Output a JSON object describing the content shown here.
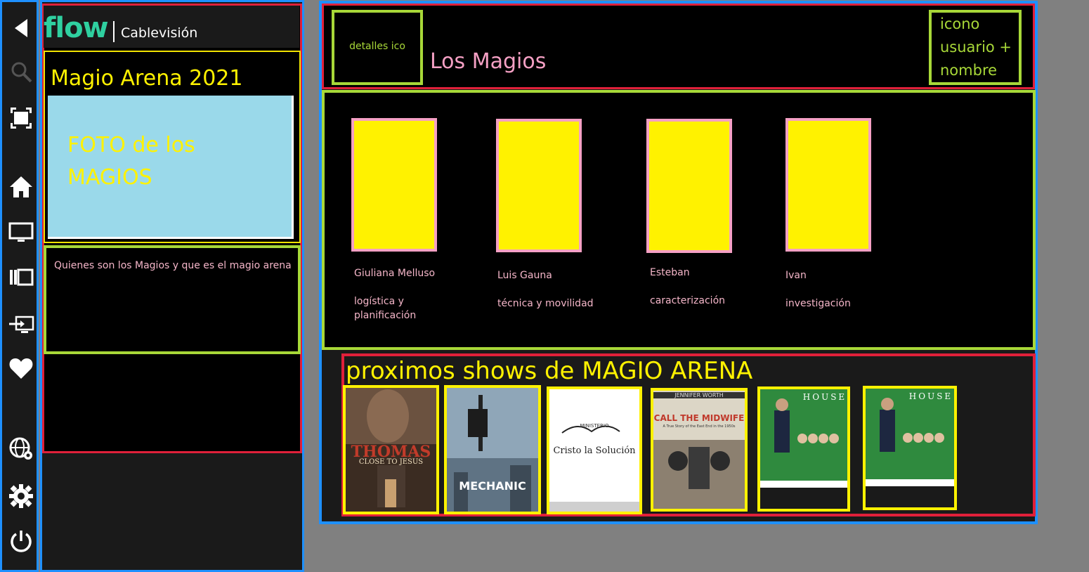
{
  "logo": {
    "brand": "flow",
    "provider": "Cablevisión"
  },
  "rail": {
    "icons": [
      "back-arrow-icon",
      "search-icon",
      "fullscreen-icon",
      "home-icon",
      "tv-icon",
      "library-icon",
      "input-source-icon",
      "favorite-heart-icon",
      "globe-settings-icon",
      "gear-icon",
      "power-icon"
    ]
  },
  "event": {
    "title": "Magio Arena 2021",
    "photo_placeholder": "FOTO de los MAGIOS",
    "description": "Quienes son los Magios y que es el magio arena"
  },
  "header": {
    "details_label": "detalles ico",
    "title": "Los Magios",
    "user_label": "icono usuario + nombre"
  },
  "team": [
    {
      "name": "Giuliana Melluso",
      "role": "logística y planificación"
    },
    {
      "name": "Luis Gauna",
      "role": "técnica y movilidad"
    },
    {
      "name": "Esteban",
      "role": "caracterización"
    },
    {
      "name": "Ivan",
      "role": "investigación"
    }
  ],
  "shows": {
    "title": "proximos shows de MAGIO ARENA",
    "posters": [
      {
        "title": "THOMAS",
        "subtitle": "CLOSE TO JESUS"
      },
      {
        "title": "MECHANIC"
      },
      {
        "title": "Cristo la Solución",
        "top": "MINISTERIO"
      },
      {
        "title": "CALL THE MIDWIFE",
        "top": "JENNIFER WORTH",
        "subtitle": "A True Story of the East End in the 1950s"
      },
      {
        "title": "HOUSE"
      },
      {
        "title": "HOUSE"
      }
    ]
  },
  "colors": {
    "accent_yellow": "#fff200",
    "accent_green": "#a8d838",
    "accent_pink": "#f5a0c4",
    "frame_blue": "#1e90ff",
    "frame_red": "#e0203a",
    "flow_teal": "#2fd0a0",
    "photo_blue": "#9ad9ea"
  }
}
